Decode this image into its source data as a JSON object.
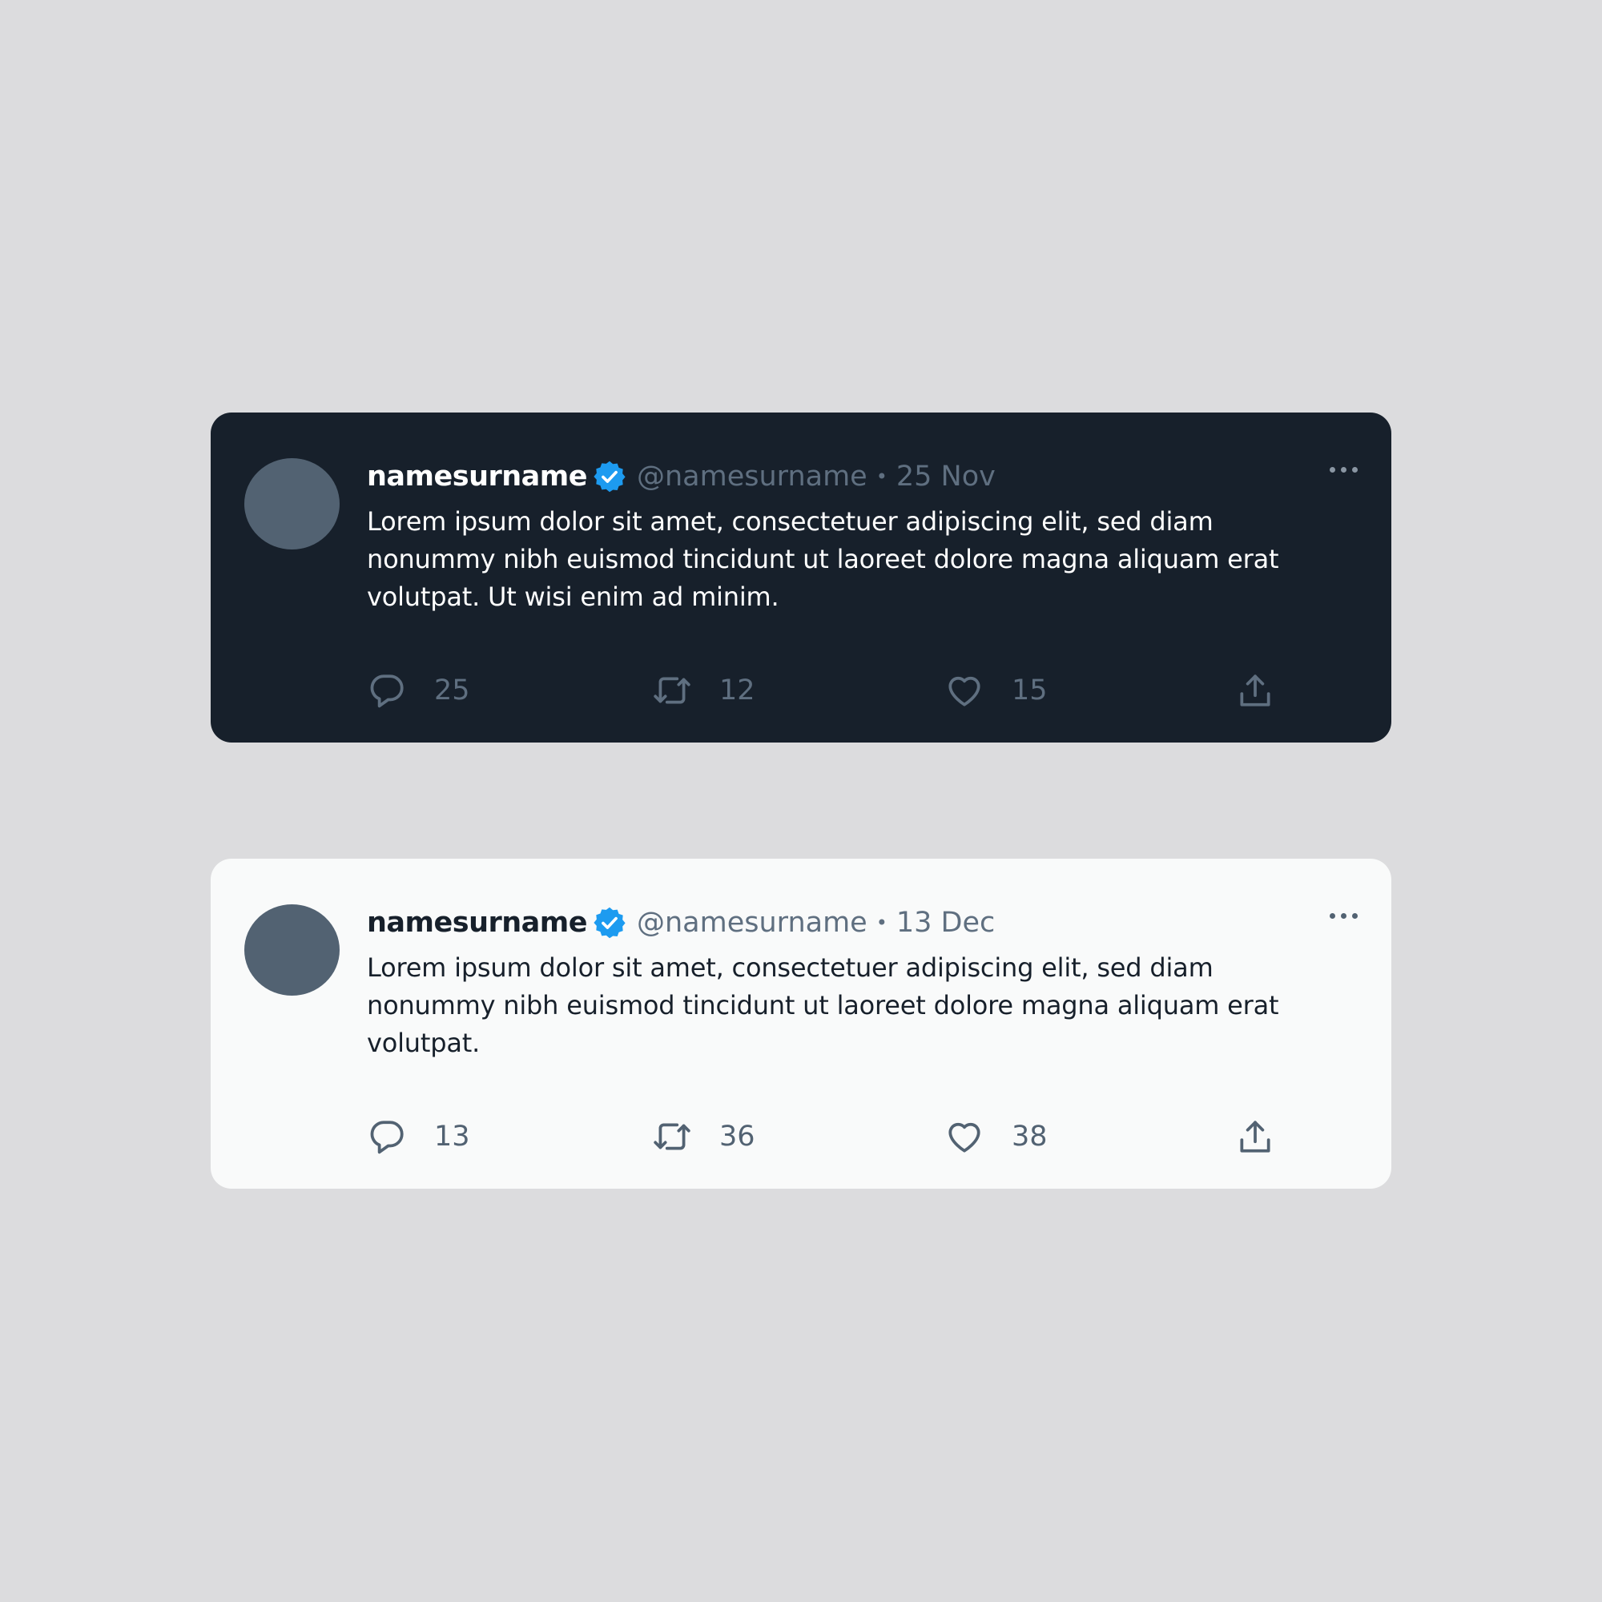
{
  "colors": {
    "background": "#dcdcde",
    "dark_card": "#17202b",
    "light_card": "#f9fafa",
    "avatar": "#526272",
    "verified_badge": "#1d9bf0",
    "muted_text": "#5f6f80"
  },
  "tweets": [
    {
      "theme": "dark",
      "name": "namesurname",
      "handle": "@namesurname",
      "separator": "•",
      "date": "25 Nov",
      "text": "Lorem ipsum dolor sit amet, consectetuer adipiscing elit, sed diam nonummy nibh euismod tincidunt ut laoreet dolore magna aliquam erat volutpat. Ut wisi enim ad minim.",
      "replies": "25",
      "retweets": "12",
      "likes": "15",
      "icons": [
        "verified-badge-icon",
        "more-options-icon",
        "reply-icon",
        "retweet-icon",
        "like-icon",
        "share-icon"
      ]
    },
    {
      "theme": "light",
      "name": "namesurname",
      "handle": "@namesurname",
      "separator": "•",
      "date": "13 Dec",
      "text": "Lorem ipsum dolor sit amet, consectetuer adipiscing elit, sed diam nonummy nibh euismod tincidunt ut laoreet dolore magna aliquam erat volutpat.",
      "replies": "13",
      "retweets": "36",
      "likes": "38",
      "icons": [
        "verified-badge-icon",
        "more-options-icon",
        "reply-icon",
        "retweet-icon",
        "like-icon",
        "share-icon"
      ]
    }
  ]
}
